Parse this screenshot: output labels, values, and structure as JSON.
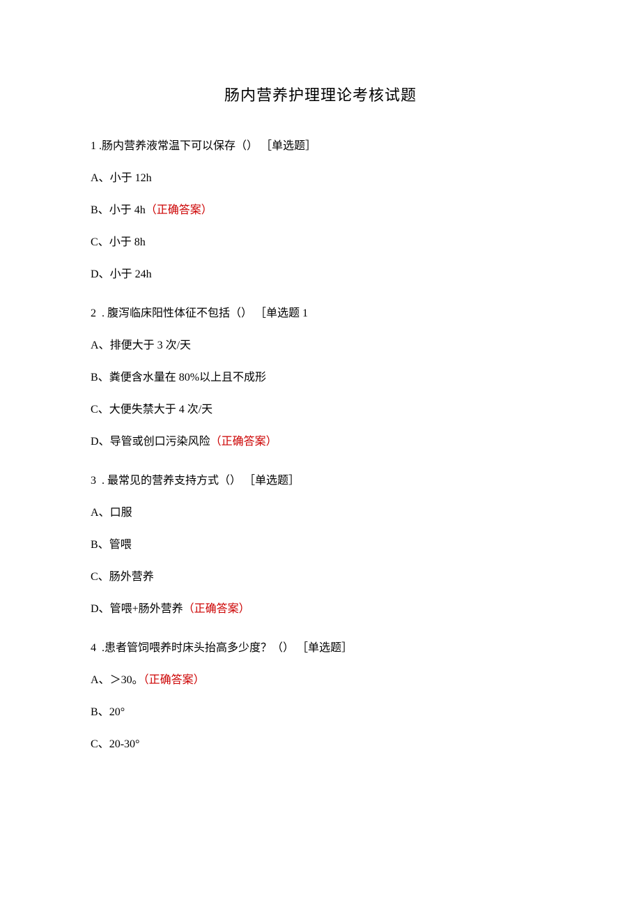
{
  "title": "肠内营养护理理论考核试题",
  "correct_label": "（正确答案）",
  "questions": [
    {
      "num": "1",
      "stem": ".肠内营养液常温下可以保存（） ［单选题］",
      "options": [
        {
          "label": "A、",
          "text": "小于 12h",
          "correct": false
        },
        {
          "label": "B、",
          "text": "小于 4h",
          "correct": true
        },
        {
          "label": "C、",
          "text": "小于 8h",
          "correct": false
        },
        {
          "label": "D、",
          "text": "小于 24h",
          "correct": false
        }
      ]
    },
    {
      "num": "2",
      "stem": " . 腹泻临床阳性体征不包括（） ［单选题 1",
      "options": [
        {
          "label": "A、",
          "text": "排便大于 3 次/天",
          "correct": false
        },
        {
          "label": "B、",
          "text": "粪便含水量在 80%以上且不成形",
          "correct": false
        },
        {
          "label": "C、",
          "text": "大便失禁大于 4 次/天",
          "correct": false
        },
        {
          "label": "D、",
          "text": "导管或创口污染风险",
          "correct": true
        }
      ]
    },
    {
      "num": "3",
      "stem": " . 最常见的营养支持方式（） ［单选题］",
      "options": [
        {
          "label": "A、",
          "text": "口服",
          "correct": false
        },
        {
          "label": "B、",
          "text": "管喂",
          "correct": false
        },
        {
          "label": "C、",
          "text": "肠外营养",
          "correct": false
        },
        {
          "label": "D、",
          "text": "管喂+肠外营养",
          "correct": true
        }
      ]
    },
    {
      "num": "4",
      "stem": " .患者管饲喂养时床头抬高多少度？（） ［单选题］",
      "options": [
        {
          "label": "A、",
          "text": "＞30。",
          "correct": true
        },
        {
          "label": "B、",
          "text": "20°",
          "correct": false
        },
        {
          "label": "C、",
          "text": "20-30°",
          "correct": false
        }
      ]
    }
  ]
}
